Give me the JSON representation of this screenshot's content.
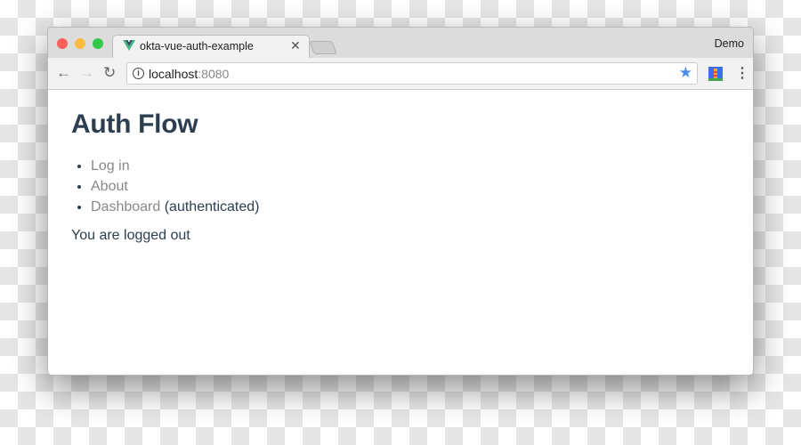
{
  "browser": {
    "tab_title": "okta-vue-auth-example",
    "profile": "Demo",
    "url_host": "localhost",
    "url_port": ":8080",
    "icons": [
      "vue-logo",
      "close",
      "back",
      "forward",
      "reload",
      "info",
      "star",
      "lighthouse-extension",
      "menu"
    ]
  },
  "page": {
    "title": "Auth Flow",
    "links": [
      {
        "label": "Log in"
      },
      {
        "label": "About"
      },
      {
        "label": "Dashboard",
        "suffix": " (authenticated)"
      }
    ],
    "status": "You are logged out"
  },
  "colors": {
    "text": "#2c3e50",
    "link": "#888888",
    "star": "#4a8ef0"
  }
}
